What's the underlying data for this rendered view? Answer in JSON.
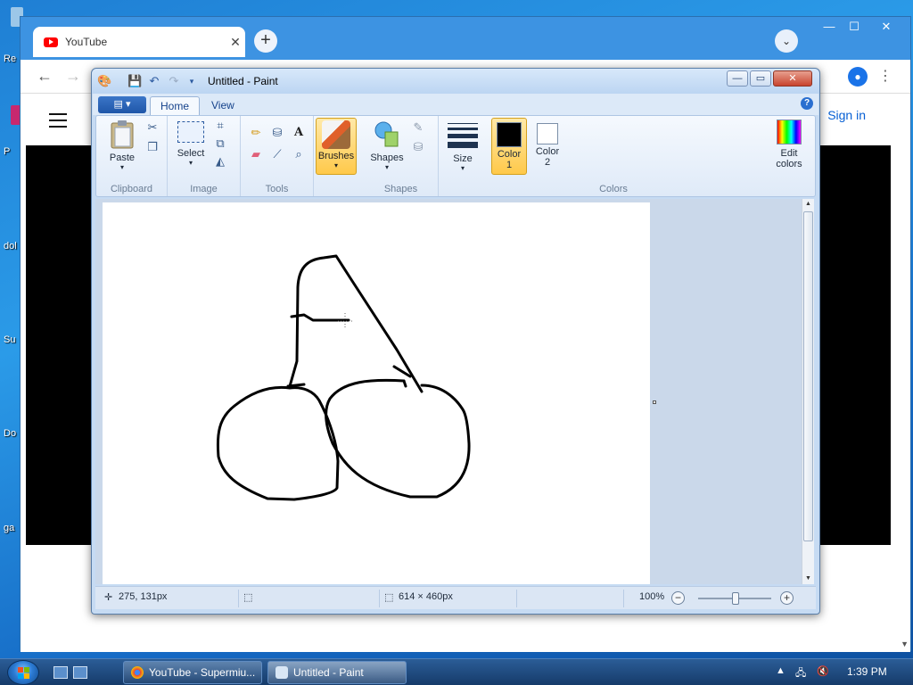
{
  "desktop": {
    "icon_labels": [
      "Re",
      "P",
      "dol",
      "Su",
      "Do",
      "ga"
    ]
  },
  "chrome": {
    "tab_title": "YouTube",
    "tab_close": "✕",
    "new_tab": "+",
    "window_controls": [
      "—",
      "☐",
      "✕"
    ],
    "sign_in": "Sign in"
  },
  "paint": {
    "title": "Untitled - Paint",
    "tabs": [
      "Home",
      "View"
    ],
    "file_menu": "▤ ▾",
    "help": "?",
    "groups": {
      "clipboard": {
        "label": "Clipboard",
        "paste": "Paste"
      },
      "image": {
        "label": "Image",
        "select": "Select"
      },
      "tools": {
        "label": "Tools"
      },
      "brushes": {
        "label": "Brushes"
      },
      "shapes": {
        "label": "Shapes",
        "shapes_btn": "Shapes"
      },
      "size": {
        "label": "Size"
      },
      "colors": {
        "label": "Colors",
        "color1": "Color",
        "color1_num": "1",
        "color2": "Color",
        "color2_num": "2",
        "edit_colors_1": "Edit",
        "edit_colors_2": "colors"
      }
    },
    "palette_row1": [
      "#000000",
      "#7f7f7f",
      "#880015",
      "#ed1c24",
      "#ff7f27",
      "#fff200",
      "#22b14c",
      "#00a2e8",
      "#3f48cc",
      "#a349a4"
    ],
    "palette_row2": [
      "#ffffff",
      "#c3c3c3",
      "#b97a57",
      "#ffaec9",
      "#ffc90e",
      "#efe4b0",
      "#b5e61d",
      "#99d9ea",
      "#7092be",
      "#c8bfe7"
    ],
    "color1_value": "#000000",
    "color2_value": "#ffffff",
    "status": {
      "cursor_pos": "275, 131px",
      "canvas_size": "614 × 460px",
      "zoom": "100%"
    }
  },
  "taskbar": {
    "tasks": [
      "YouTube - Supermiu...",
      "Untitled - Paint"
    ],
    "clock": "1:39 PM"
  }
}
